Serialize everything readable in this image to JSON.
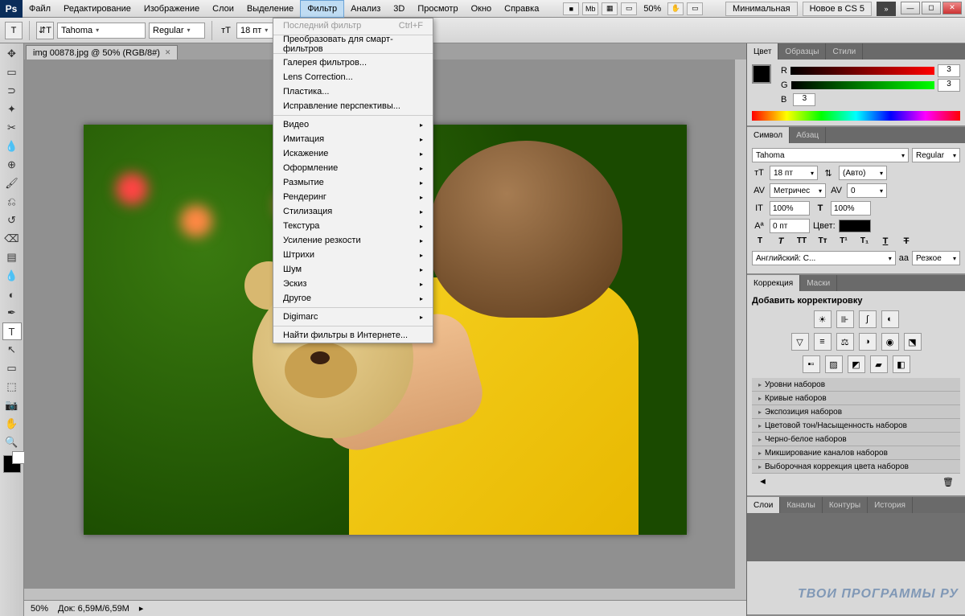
{
  "menubar": {
    "items": [
      "Файл",
      "Редактирование",
      "Изображение",
      "Слои",
      "Выделение",
      "Фильтр",
      "Анализ",
      "3D",
      "Просмотр",
      "Окно",
      "Справка"
    ],
    "active_index": 5,
    "zoom": "50%",
    "workspace1": "Минимальная",
    "workspace2": "Новое в CS 5"
  },
  "options": {
    "font": "Tahoma",
    "style": "Regular",
    "size": "18 пт"
  },
  "filter_menu": {
    "last": {
      "label": "Последний фильтр",
      "shortcut": "Ctrl+F"
    },
    "smart": "Преобразовать для смарт-фильтров",
    "gallery": "Галерея фильтров...",
    "lens": "Lens Correction...",
    "liquify": "Пластика...",
    "vanish": "Исправление перспективы...",
    "subs": [
      "Видео",
      "Имитация",
      "Искажение",
      "Оформление",
      "Размытие",
      "Рендеринг",
      "Стилизация",
      "Текстура",
      "Усиление резкости",
      "Штрихи",
      "Шум",
      "Эскиз",
      "Другое"
    ],
    "digimarc": "Digimarc",
    "browse": "Найти фильтры в Интернете..."
  },
  "document": {
    "tab": "img 00878.jpg @ 50% (RGB/8#)",
    "status_zoom": "50%",
    "status_doc": "Док: 6,59M/6,59M"
  },
  "color_panel": {
    "tabs": [
      "Цвет",
      "Образцы",
      "Стили"
    ],
    "r": "3",
    "g": "3",
    "b": "3"
  },
  "char_panel": {
    "tabs": [
      "Символ",
      "Абзац"
    ],
    "font": "Tahoma",
    "style": "Regular",
    "size": "18 пт",
    "leading": "(Авто)",
    "kerning": "Метричес",
    "tracking": "0",
    "vscale": "100%",
    "hscale": "100%",
    "baseline": "0 пт",
    "color_label": "Цвет:",
    "lang": "Английский: С...",
    "aa_label": "aа",
    "aa": "Резкое"
  },
  "adj_panel": {
    "tabs": [
      "Коррекция",
      "Маски"
    ],
    "add": "Добавить корректировку",
    "presets": [
      "Уровни наборов",
      "Кривые наборов",
      "Экспозиция наборов",
      "Цветовой тон/Насыщенность наборов",
      "Черно-белое наборов",
      "Микширование каналов наборов",
      "Выборочная коррекция цвета наборов"
    ]
  },
  "layers_panel": {
    "tabs": [
      "Слои",
      "Каналы",
      "Контуры",
      "История"
    ]
  },
  "watermark": "ТВОИ ПРОГРАММЫ РУ"
}
